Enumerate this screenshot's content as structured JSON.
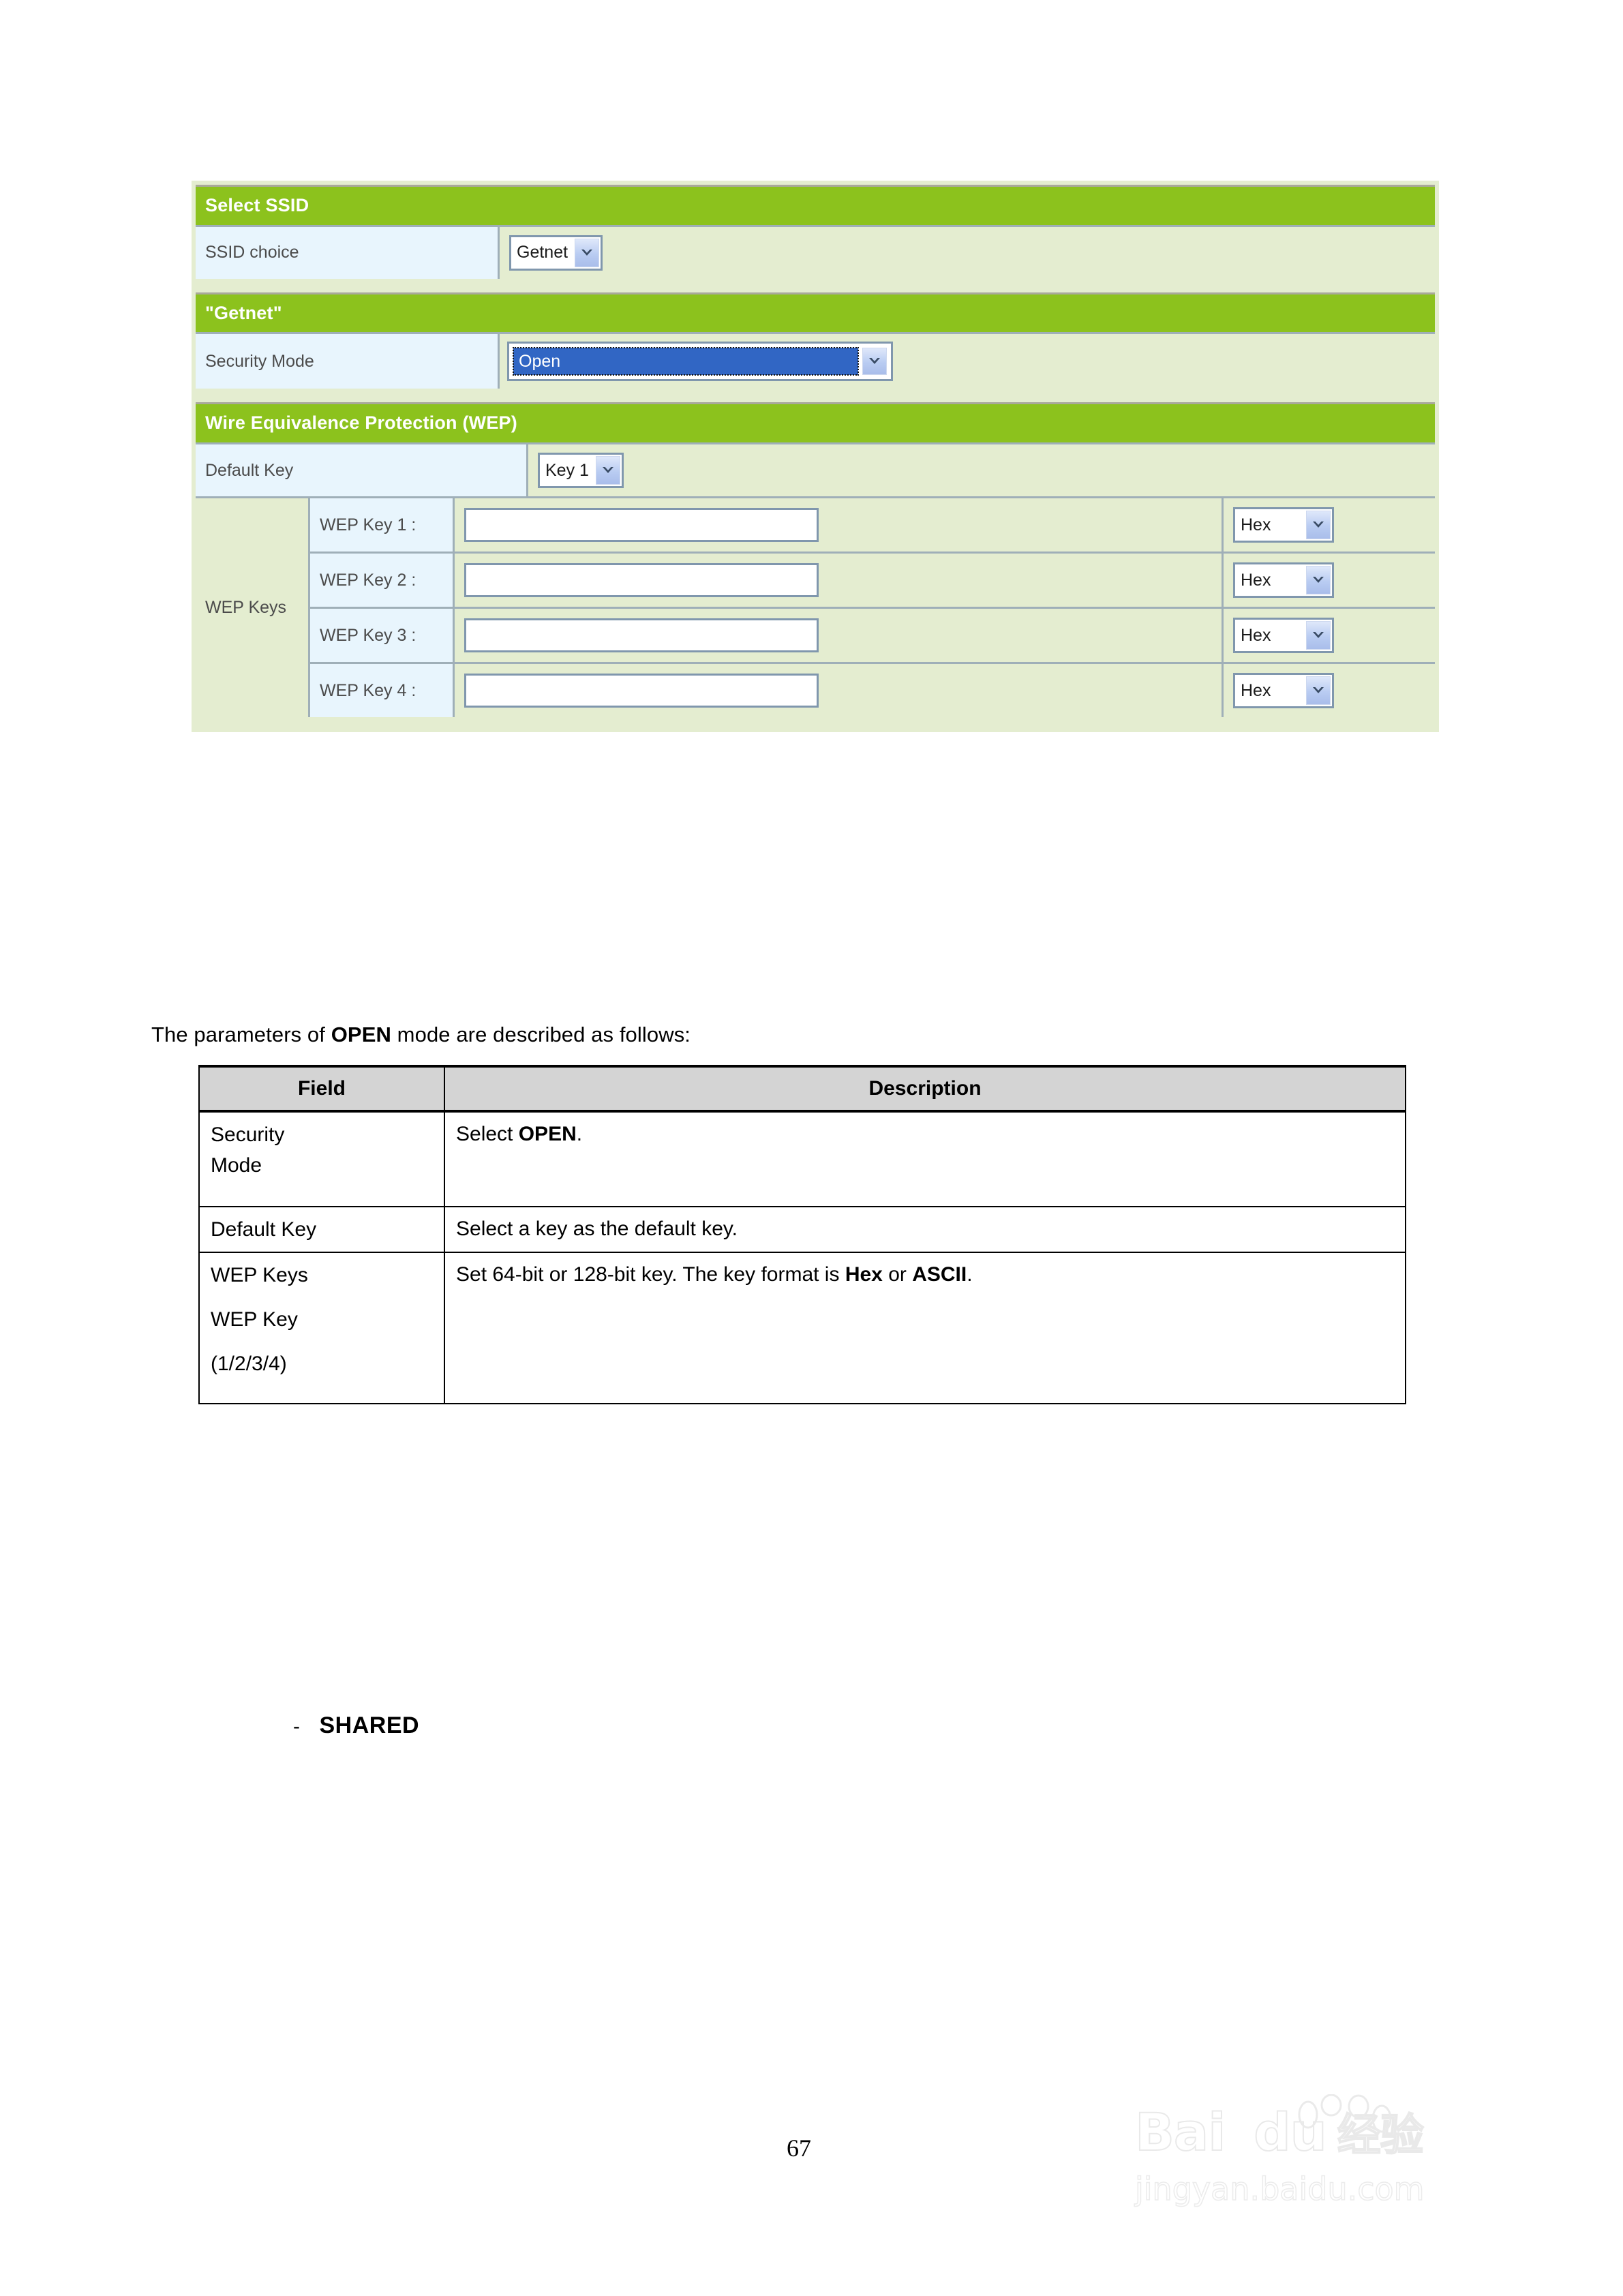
{
  "router_panel": {
    "groups": [
      {
        "header": "Select SSID",
        "rows": [
          {
            "label": "SSID choice",
            "control": "select",
            "value": "Getnet"
          }
        ]
      },
      {
        "header": "\"Getnet\"",
        "rows": [
          {
            "label": "Security Mode",
            "control": "select-focused",
            "value": "Open"
          }
        ]
      },
      {
        "header": "Wire Equivalence Protection (WEP)",
        "rows": [
          {
            "label": "Default Key",
            "control": "select",
            "value": "Key 1"
          }
        ],
        "wep": {
          "group_label": "WEP Keys",
          "keys": [
            {
              "label": "WEP Key 1 :",
              "value": "",
              "format": "Hex"
            },
            {
              "label": "WEP Key 2 :",
              "value": "",
              "format": "Hex"
            },
            {
              "label": "WEP Key 3 :",
              "value": "",
              "format": "Hex"
            },
            {
              "label": "WEP Key 4 :",
              "value": "",
              "format": "Hex"
            }
          ]
        }
      }
    ],
    "colors": {
      "header_green": "#8cc21d",
      "panel_green": "#e4edd0",
      "label_blue": "#e8f5fd",
      "select_highlight": "#3166c4",
      "border_gray": "#9fafb8"
    }
  },
  "intro": {
    "prefix": "The parameters of ",
    "emphasis": "OPEN",
    "suffix": " mode are described as follows:"
  },
  "desc_table": {
    "headers": [
      "Field",
      "Description"
    ],
    "rows": [
      {
        "field": "Security\nMode",
        "field_lines": [
          "Security",
          "Mode"
        ],
        "desc_prefix": "Select ",
        "desc_emphasis": "OPEN",
        "desc_suffix": "."
      },
      {
        "field": "Default Key",
        "field_lines": [
          "Default Key"
        ],
        "desc_prefix": "Select a key as the default key.",
        "desc_emphasis": "",
        "desc_suffix": ""
      },
      {
        "field": "WEP Keys WEP Key (1/2/3/4)",
        "field_lines": [
          "WEP Keys",
          "WEP Key",
          "(1/2/3/4)"
        ],
        "desc_prefix": "Set 64-bit or 128-bit key. The key format is ",
        "desc_emphasis": "Hex",
        "desc_middle": " or ",
        "desc_emphasis2": "ASCII",
        "desc_suffix": "."
      }
    ]
  },
  "shared_section": {
    "dash": "-",
    "label": "SHARED"
  },
  "footer": {
    "page_number": "67"
  },
  "watermark": {
    "logo": "Bai du",
    "logo_left": "Bai",
    "logo_right": "du",
    "suffix_cn": "经验",
    "url": "jingyan.baidu.com"
  }
}
